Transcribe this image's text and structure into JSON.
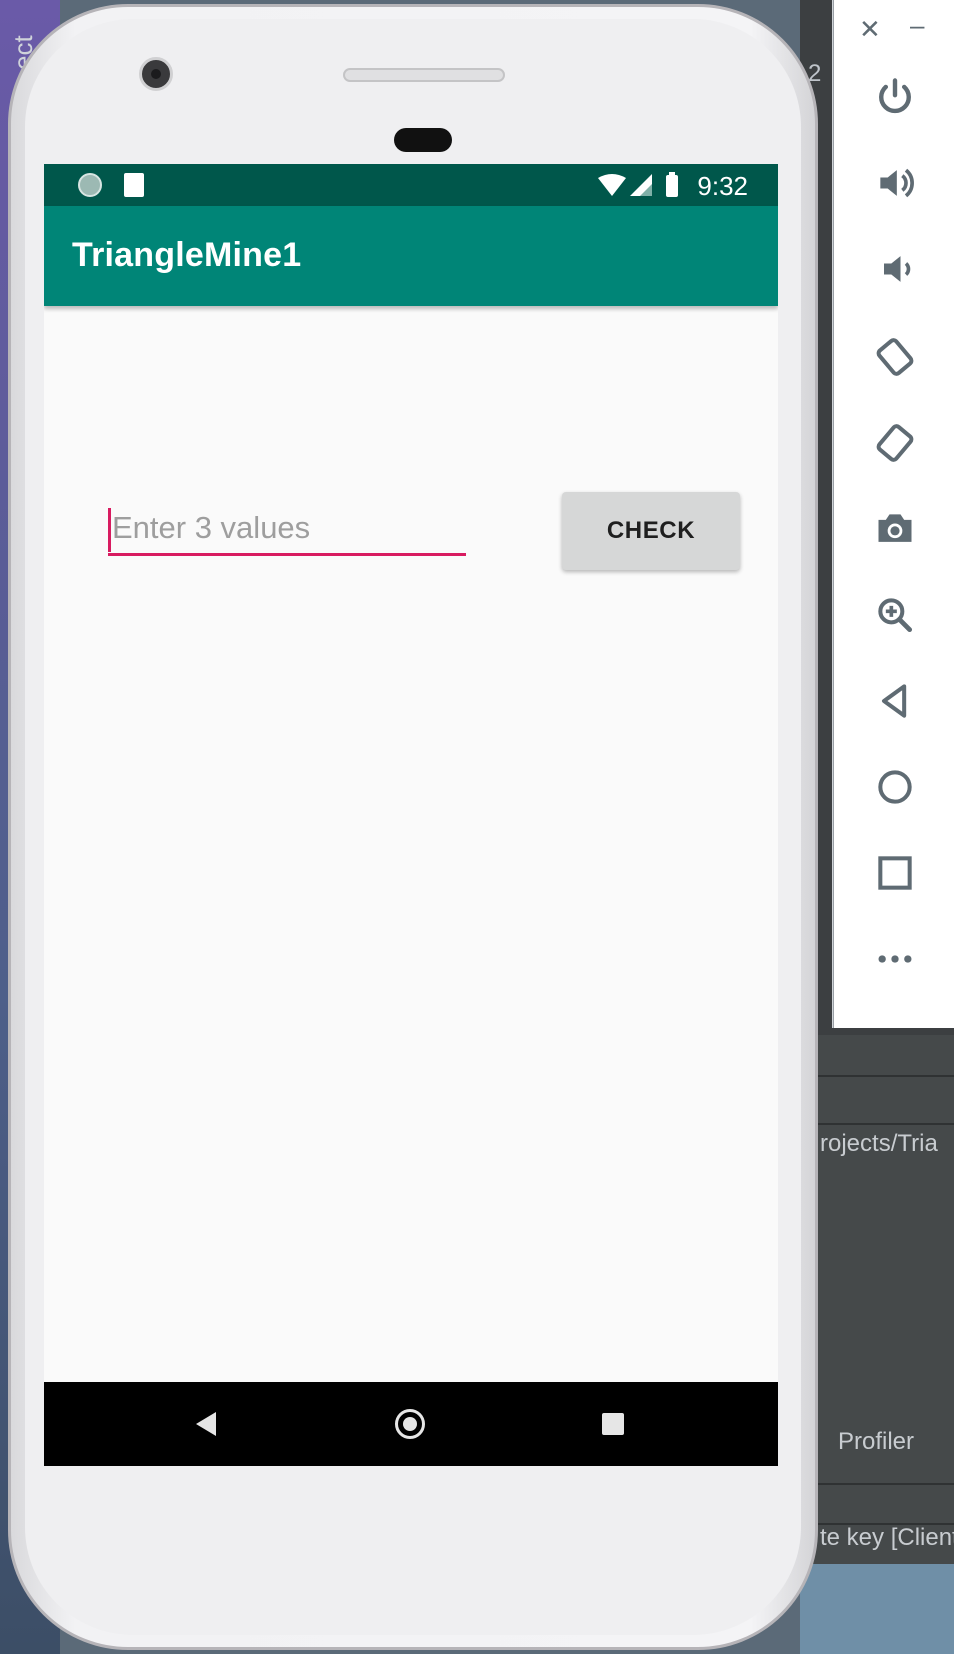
{
  "app": {
    "title": "TriangleMine1"
  },
  "statusbar": {
    "time": "9:32",
    "icons": [
      "sync-icon",
      "sd-card-icon",
      "wifi-icon",
      "signal-icon",
      "battery-icon"
    ]
  },
  "main": {
    "input_placeholder": "Enter 3 values",
    "input_value": "",
    "check_label": "CHECK"
  },
  "navbar": {
    "icons": [
      "back-icon",
      "home-icon",
      "recents-icon"
    ]
  },
  "emulator_panel": {
    "controls": [
      "close-icon",
      "minimize-icon",
      "power-icon",
      "volume-up-icon",
      "volume-down-icon",
      "rotate-left-icon",
      "rotate-right-icon",
      "camera-icon",
      "zoom-icon",
      "back-icon",
      "home-icon",
      "overview-icon",
      "more-icon"
    ]
  },
  "background": {
    "ide_tab_fragment": "ect",
    "ide_number_fragment": "2",
    "path_fragment": "rojects/Tria",
    "profiler_label": "Profiler",
    "status_fragment": "te key [Client"
  },
  "colors": {
    "status_bar": "#00574b",
    "app_bar": "#008577",
    "accent": "#d81b60",
    "screen_bg": "#fafafa"
  }
}
